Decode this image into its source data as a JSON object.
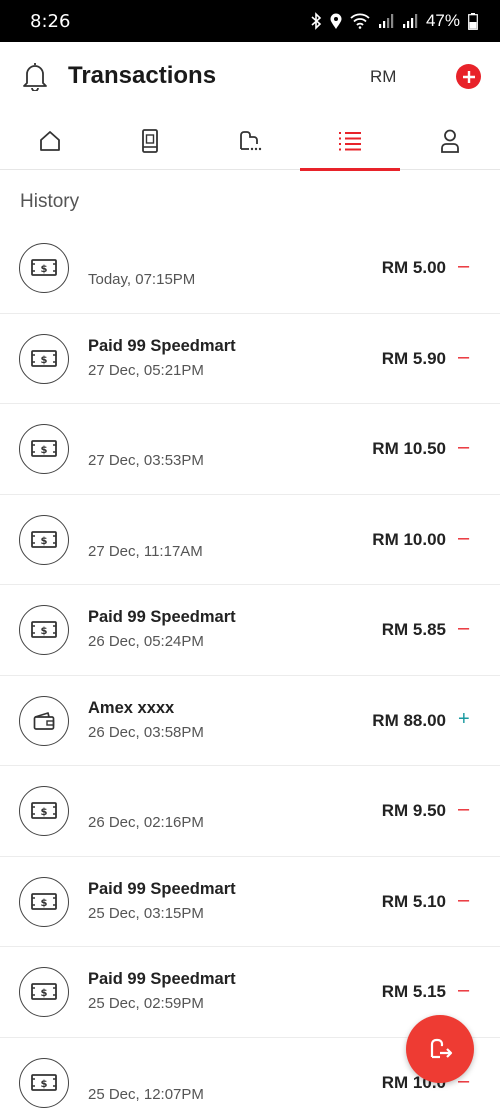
{
  "status": {
    "time": "8:26",
    "battery": "47%"
  },
  "header": {
    "title": "Transactions",
    "currency": "RM"
  },
  "tabs": [
    {
      "name": "home",
      "icon": "home-icon",
      "active": false
    },
    {
      "name": "device",
      "icon": "phone-icon",
      "active": false
    },
    {
      "name": "cards",
      "icon": "card-stack-icon",
      "active": false
    },
    {
      "name": "transactions",
      "icon": "list-icon",
      "active": true
    },
    {
      "name": "profile",
      "icon": "person-icon",
      "active": false
    }
  ],
  "section_title": "History",
  "transactions": [
    {
      "merchant": "",
      "date": "Today, 07:15PM",
      "amount": "RM 5.00",
      "sign": "–",
      "type": "debit",
      "icon": "cash-icon"
    },
    {
      "merchant": "Paid 99 Speedmart",
      "date": "27 Dec, 05:21PM",
      "amount": "RM 5.90",
      "sign": "–",
      "type": "debit",
      "icon": "cash-icon"
    },
    {
      "merchant": "",
      "date": "27 Dec, 03:53PM",
      "amount": "RM 10.50",
      "sign": "–",
      "type": "debit",
      "icon": "cash-icon"
    },
    {
      "merchant": "",
      "date": "27 Dec, 11:17AM",
      "amount": "RM 10.00",
      "sign": "–",
      "type": "debit",
      "icon": "cash-icon"
    },
    {
      "merchant": "Paid 99 Speedmart",
      "date": "26 Dec, 05:24PM",
      "amount": "RM 5.85",
      "sign": "–",
      "type": "debit",
      "icon": "cash-icon"
    },
    {
      "merchant": "Amex xxxx",
      "date": "26 Dec, 03:58PM",
      "amount": "RM 88.00",
      "sign": "+",
      "type": "credit",
      "icon": "wallet-icon"
    },
    {
      "merchant": "",
      "date": "26 Dec, 02:16PM",
      "amount": "RM 9.50",
      "sign": "–",
      "type": "debit",
      "icon": "cash-icon"
    },
    {
      "merchant": "Paid 99 Speedmart",
      "date": "25 Dec, 03:15PM",
      "amount": "RM 5.10",
      "sign": "–",
      "type": "debit",
      "icon": "cash-icon"
    },
    {
      "merchant": "Paid 99 Speedmart",
      "date": "25 Dec, 02:59PM",
      "amount": "RM 5.15",
      "sign": "–",
      "type": "debit",
      "icon": "cash-icon"
    },
    {
      "merchant": "",
      "date": "25 Dec, 12:07PM",
      "amount": "RM 10.0",
      "sign": "–",
      "type": "debit",
      "icon": "cash-icon"
    }
  ],
  "colors": {
    "accent": "#e8232a",
    "credit": "#1a9aa0"
  }
}
